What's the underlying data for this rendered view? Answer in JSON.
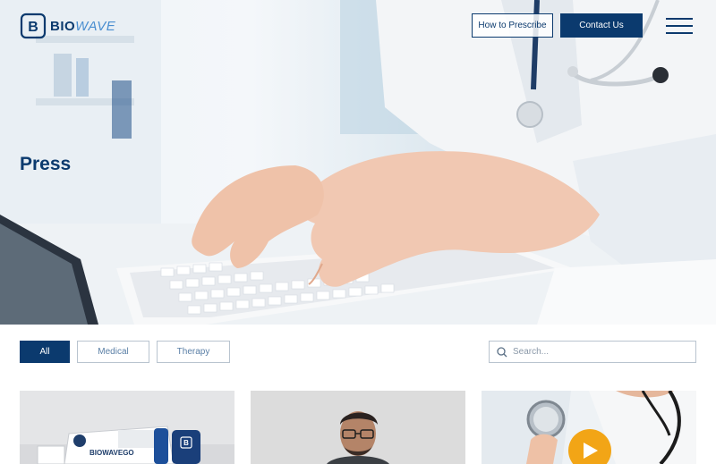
{
  "brand": {
    "name_part1": "BIO",
    "name_part2": "WAVE",
    "mark_letter": "B"
  },
  "header": {
    "prescribe_label": "How to Prescribe",
    "contact_label": "Contact Us"
  },
  "hero": {
    "title": "Press"
  },
  "filters": [
    {
      "label": "All",
      "active": true
    },
    {
      "label": "Medical",
      "active": false
    },
    {
      "label": "Therapy",
      "active": false
    }
  ],
  "search": {
    "placeholder": "Search..."
  },
  "cards": [
    {
      "product_text": "BIOWAVEGO",
      "badge_letter": "B"
    },
    {
      "subject": "man-with-glasses"
    },
    {
      "subject": "doctor-with-stethoscope",
      "has_play": true
    }
  ],
  "colors": {
    "brand_navy": "#0b3a6e",
    "brand_light": "#4a8ed0",
    "play_orange": "#f2a516"
  }
}
